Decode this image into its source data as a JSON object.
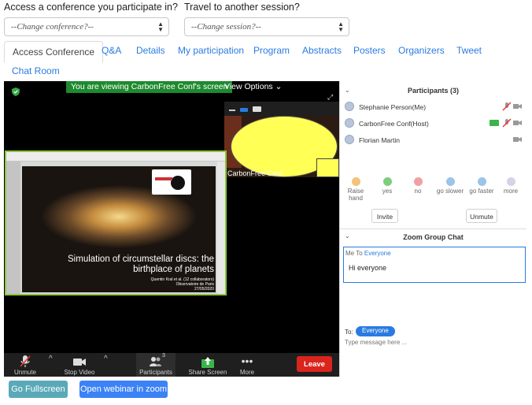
{
  "selectors": {
    "conference_label": "Access a conference you participate in?",
    "conference_value": "--Change conference?--",
    "session_label": "Travel to another session?",
    "session_value": "--Change session?--"
  },
  "tabs": [
    {
      "label": "Access Conference",
      "active": true
    },
    {
      "label": "Q&A"
    },
    {
      "label": "Details"
    },
    {
      "label": "My participation"
    },
    {
      "label": "Program"
    },
    {
      "label": "Abstracts"
    },
    {
      "label": "Posters"
    },
    {
      "label": "Organizers"
    },
    {
      "label": "Tweet"
    },
    {
      "label": "Chat Room"
    }
  ],
  "meeting": {
    "banner": "You are viewing CarbonFree Conf's screen",
    "view_options": "View Options",
    "thumbnail_name": "CarbonFree Conf",
    "slide": {
      "title_line1": "Simulation of circumstellar discs: the",
      "title_line2": "birthplace of planets",
      "author_line1": "Quentin Kral et al. (12 collaborators)",
      "author_line2": "Observatoire de Paris",
      "author_line3": "27/05/2020"
    },
    "controls": {
      "unmute": "Unmute",
      "stop_video": "Stop Video",
      "participants": "Participants",
      "participants_count": "3",
      "share_screen": "Share Screen",
      "more": "More",
      "leave": "Leave"
    }
  },
  "participants_panel": {
    "title": "Participants (3)",
    "people": [
      {
        "name": "Stephanie Person(Me)"
      },
      {
        "name": "CarbonFree Conf(Host)"
      },
      {
        "name": "Florian Martin"
      }
    ],
    "reactions": [
      "Raise hand",
      "yes",
      "no",
      "go slower",
      "go faster",
      "more"
    ],
    "invite": "Invite",
    "unmute": "Unmute"
  },
  "chat": {
    "title": "Zoom Group Chat",
    "from": "Me",
    "to_word": "To",
    "to_target": "Everyone",
    "message": "Hi everyone",
    "to_label": "To:",
    "recipient": "Everyone",
    "placeholder": "Type message here ..."
  },
  "buttons": {
    "fullscreen": "Go Fullscreen",
    "webinar": "Open webinar in zoom"
  },
  "colors": {
    "link_blue": "#2a7ae2",
    "banner_green": "#1e8a2f",
    "leave_red": "#d9251d",
    "fullscreen_teal": "#5aa9b8",
    "webinar_blue": "#3b82f6"
  }
}
